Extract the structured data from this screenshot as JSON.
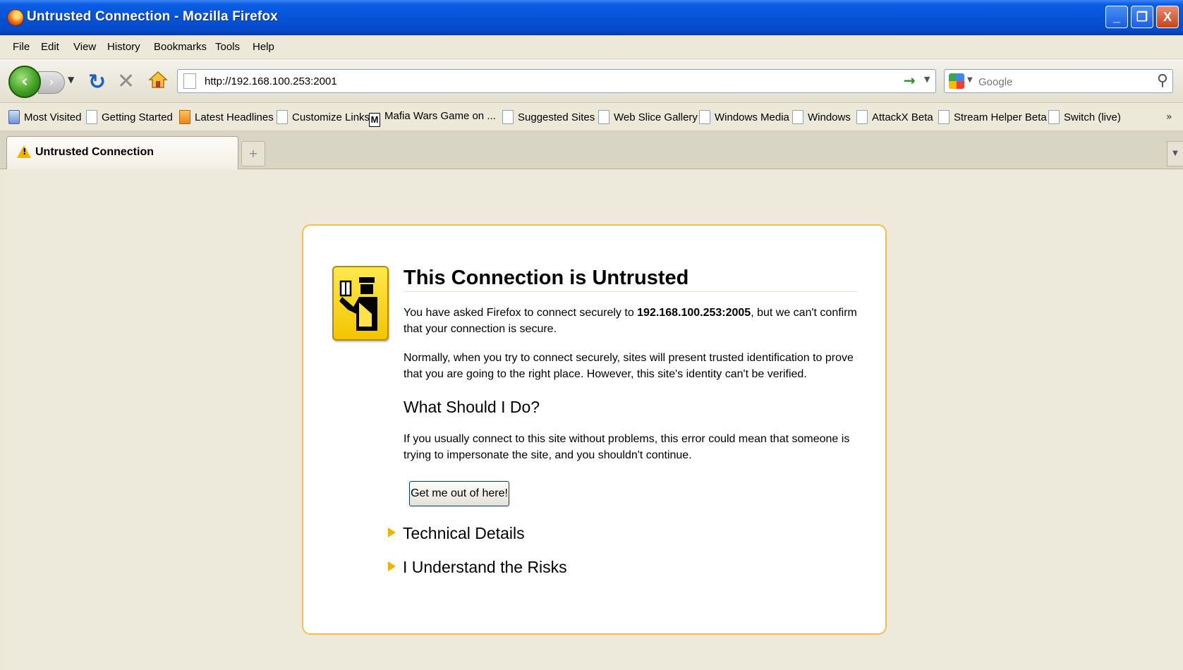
{
  "window": {
    "title": "Untrusted Connection - Mozilla Firefox",
    "min": "_",
    "max": "❐",
    "close": "X"
  },
  "menu": [
    "File",
    "Edit",
    "View",
    "History",
    "Bookmarks",
    "Tools",
    "Help"
  ],
  "nav": {
    "url": "http://192.168.100.253:2001",
    "search_placeholder": "Google"
  },
  "bookmarks": [
    "Most Visited",
    "Getting Started",
    "Latest Headlines",
    "Customize Links",
    "Mafia Wars Game on ...",
    "Suggested Sites",
    "Web Slice Gallery",
    "Windows Media",
    "Windows",
    "AttackX Beta",
    "Stream Helper Beta",
    "Switch (live)"
  ],
  "bookmarks_more": "»",
  "tab": {
    "label": "Untrusted Connection",
    "new_tab": "+"
  },
  "error": {
    "title": "This Connection is Untrusted",
    "p1_pre": "You have asked Firefox to connect securely to ",
    "p1_host": "192.168.100.253:2005",
    "p1_post": ", but we can't confirm that your connection is secure.",
    "p2": "Normally, when you try to connect securely, sites will present trusted identification to prove that you are going to the right place. However, this site's identity can't be verified.",
    "subhead": "What Should I Do?",
    "p3": "If you usually connect to this site without problems, this error could mean that someone is trying to impersonate the site, and you shouldn't continue.",
    "button": "Get me out of here!",
    "technical": "Technical Details",
    "risks": "I Understand the Risks"
  },
  "colors": {
    "box_border": "#f4c04d",
    "titlebar": "#0653d6",
    "content_bg": "#eeeadb"
  }
}
